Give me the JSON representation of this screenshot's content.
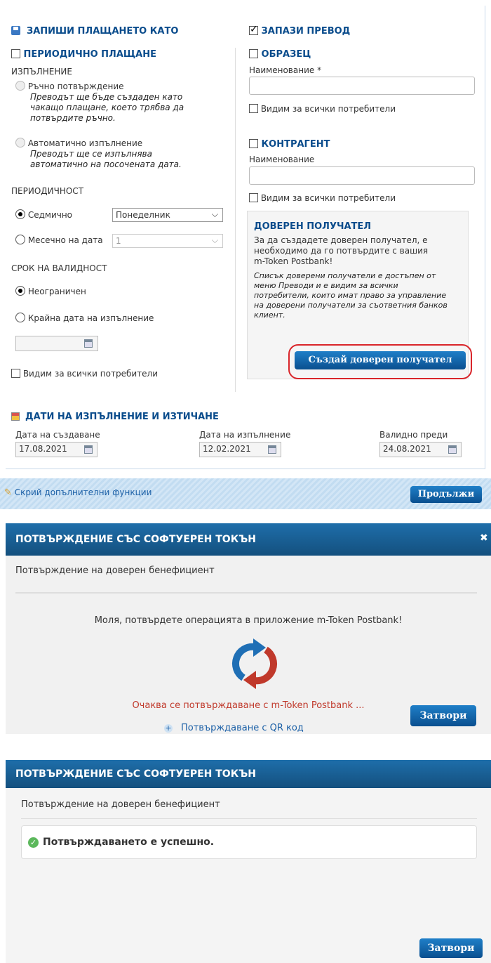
{
  "record": {
    "title": "ЗАПИШИ ПЛАЩАНЕТО КАТО",
    "periodic_label": "ПЕРИОДИЧНО ПЛАЩАНЕ",
    "execution_label": "ИЗПЪЛНЕНИЕ",
    "manual_label": "Ръчно потвърждение",
    "manual_desc_1": "Преводът ще бъде създаден като",
    "manual_desc_2": "чакащо плащане, което трябва да",
    "manual_desc_3": "потвърдите ръчно.",
    "auto_label": "Автоматично изпълнение",
    "auto_desc_1": "Преводът ще се изпълнява",
    "auto_desc_2": "автоматично на посочената дата.",
    "periodicity_label": "ПЕРИОДИЧНОСТ",
    "weekly_label": "Седмично",
    "weekly_value": "Понеделник",
    "monthly_label": "Месечно на дата",
    "monthly_value": "1",
    "validity_label": "СРОК НА ВАЛИДНОСТ",
    "unlimited_label": "Неограничен",
    "end_date_label": "Крайна дата на изпълнение",
    "visible_all": "Видим за всички потребители"
  },
  "save": {
    "title": "ЗАПАЗИ ПРЕВОД",
    "template_label": "ОБРАЗЕЦ",
    "name_required_label": "Наименование *",
    "visible_all": "Видим за всички потребители",
    "counterparty_label": "КОНТРАГЕНТ",
    "name_label": "Наименование",
    "trusted_title": "ДОВЕРЕН ПОЛУЧАТЕЛ",
    "trusted_text_1": "За да създадете доверен получател, е",
    "trusted_text_2": "необходимо да го потвърдите с вашия",
    "trusted_text_3": "m-Token Postbank!",
    "trusted_note_1": "Списък доверени получатели е достъпен от",
    "trusted_note_2": "меню Преводи и е видим за всички",
    "trusted_note_3": "потребители, които имат право за управление",
    "trusted_note_4": "на доверени получатели за съответния банков",
    "trusted_note_5": "клиент.",
    "create_trusted_button": "Създай доверен получател"
  },
  "dates": {
    "title": "ДАТИ НА ИЗПЪЛНЕНИЕ И ИЗТИЧАНЕ",
    "created_label": "Дата на създаване",
    "created_value": "17.08.2021",
    "exec_label": "Дата на изпълнение",
    "exec_value": "12.02.2021",
    "valid_label": "Валидно преди",
    "valid_value": "24.08.2021"
  },
  "footer": {
    "hide_link": "Скрий допълнителни функции",
    "continue_button": "Продължи"
  },
  "modal1": {
    "title": "ПОТВЪРЖДЕНИЕ СЪС СОФТУЕРЕН ТОКЪН",
    "subtitle": "Потвърждение на доверен бенефициент",
    "message": "Моля, потвърдете операцията в приложение m-Token Postbank!",
    "waiting": "Очаква се потвърждаване с m-Token Postbank ...",
    "qr_link": "Потвърждаване с QR код",
    "close_button": "Затвори"
  },
  "modal2": {
    "title": "ПОТВЪРЖДЕНИЕ СЪС СОФТУЕРЕН ТОКЪН",
    "subtitle": "Потвърждение на доверен бенефициент",
    "success": "Потвърждаването е успешно.",
    "close_button": "Затвори"
  },
  "colors": {
    "heading_blue": "#0a4c8c",
    "button_blue": "#0a4f8f",
    "highlight_red": "#d9252a",
    "waiting_red": "#c0392b",
    "success_green": "#5cb85c"
  }
}
